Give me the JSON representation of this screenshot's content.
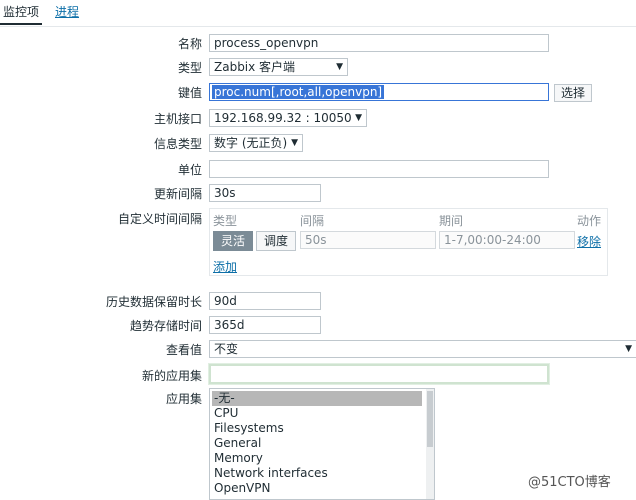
{
  "tabs": {
    "items_tab": "监控项",
    "process_tab": "进程"
  },
  "form": {
    "name_label": "名称",
    "name_value": "process_openvpn",
    "type_label": "类型",
    "type_value": "Zabbix 客户端",
    "key_label": "键值",
    "key_value": "proc.num[,root,all,openvpn]",
    "select_button": "选择",
    "interface_label": "主机接口",
    "interface_value": "192.168.99.32 : 10050",
    "info_type_label": "信息类型",
    "info_type_value": "数字 (无正负)",
    "units_label": "单位",
    "units_value": "",
    "update_interval_label": "更新间隔",
    "update_interval_value": "30s",
    "custom_intervals_label": "自定义时间间隔",
    "history_label": "历史数据保留时长",
    "history_value": "90d",
    "trends_label": "趋势存储时间",
    "trends_value": "365d",
    "show_value_label": "查看值",
    "show_value_value": "不变",
    "new_app_label": "新的应用集",
    "new_app_value": "",
    "apps_label": "应用集"
  },
  "custom_intervals": {
    "col_type": "类型",
    "col_interval": "间隔",
    "col_period": "期间",
    "col_action": "动作",
    "flexible": "灵活",
    "scheduling": "调度",
    "interval_placeholder": "50s",
    "period_placeholder": "1-7,00:00-24:00",
    "remove": "移除",
    "add": "添加"
  },
  "applications": [
    "-无-",
    "CPU",
    "Filesystems",
    "General",
    "Memory",
    "Network interfaces",
    "OpenVPN"
  ],
  "watermark": "@51CTO博客"
}
